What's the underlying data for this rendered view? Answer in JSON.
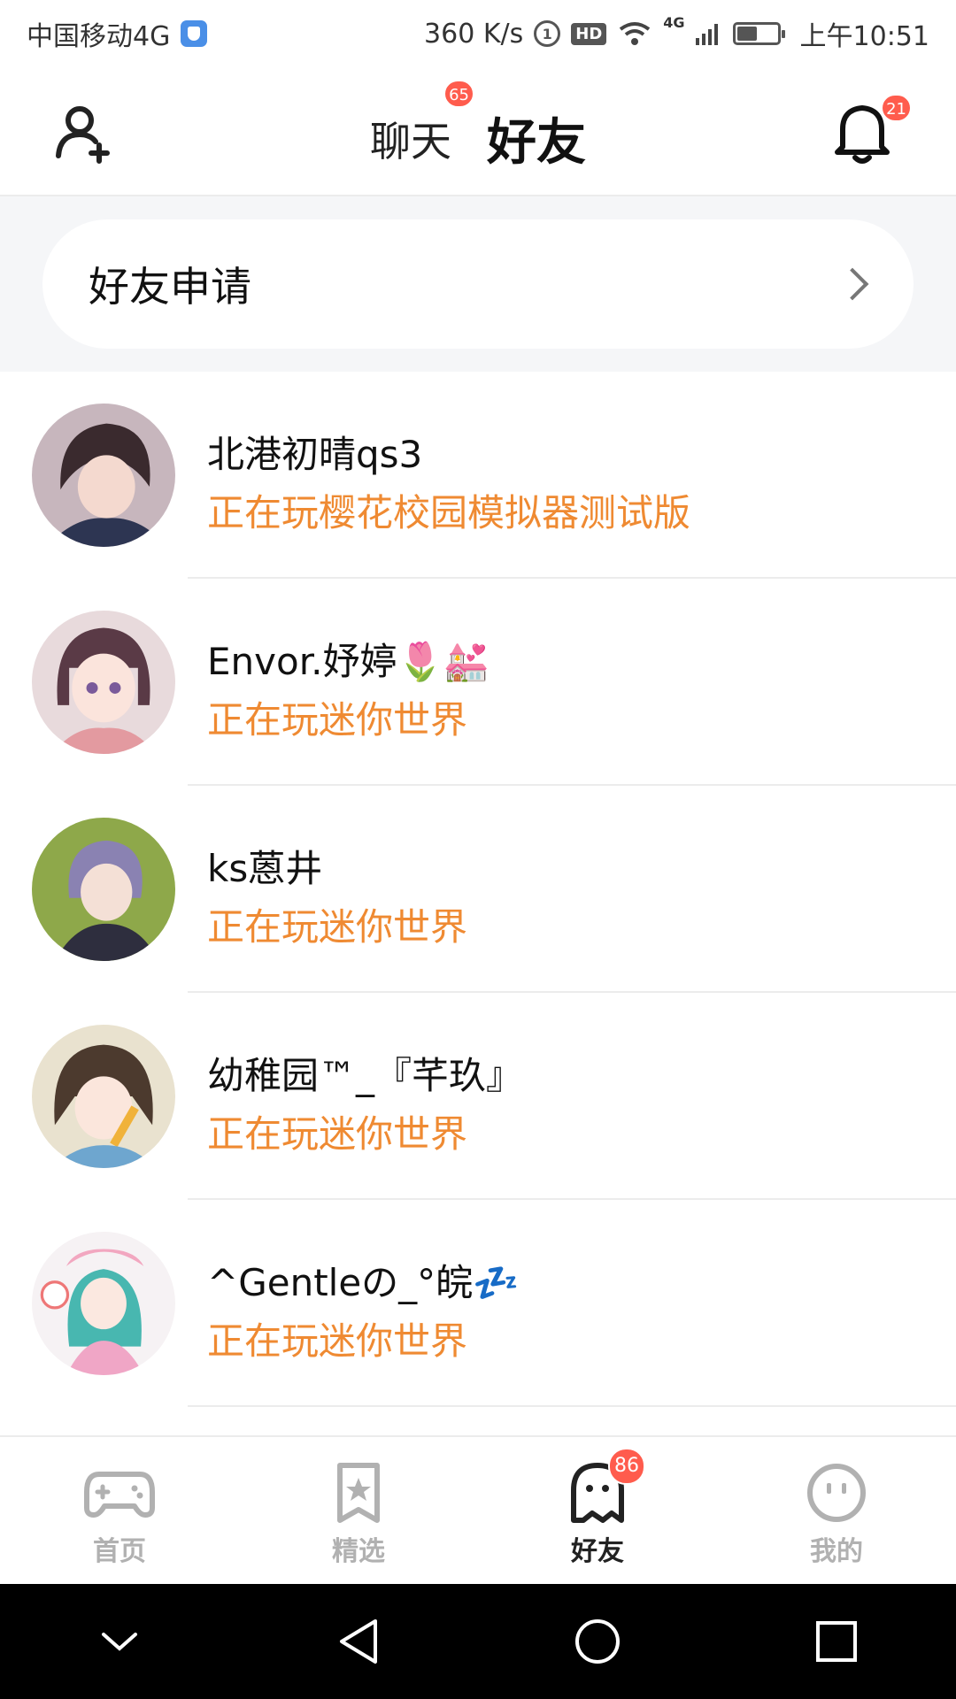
{
  "status_bar": {
    "carrier": "中国移动4G",
    "speed": "360 K/s",
    "hd": "HD",
    "network": "4G",
    "one_badge": "1",
    "time": "上午10:51",
    "battery_level": 0.5
  },
  "header": {
    "tabs": [
      {
        "label": "聊天",
        "badge": "65"
      },
      {
        "label": "好友"
      }
    ],
    "notification_badge": "21"
  },
  "friend_request": {
    "label": "好友申请"
  },
  "friends": [
    {
      "name": "北港初晴qs3",
      "status": "正在玩樱花校园模拟器测试版"
    },
    {
      "name": "Envor.妤婷🌷💒",
      "status": "正在玩迷你世界"
    },
    {
      "name": "ks蒽井",
      "status": "正在玩迷你世界"
    },
    {
      "name": "幼稚园™_『芊玖』",
      "status": "正在玩迷你世界"
    },
    {
      "name": "^Gentleの_°皖💤",
      "status": "正在玩迷你世界"
    }
  ],
  "bottom_nav": {
    "items": [
      {
        "label": "首页",
        "icon": "gamepad-icon"
      },
      {
        "label": "精选",
        "icon": "star-bookmark-icon"
      },
      {
        "label": "好友",
        "icon": "ghost-icon",
        "badge": "86"
      },
      {
        "label": "我的",
        "icon": "face-icon"
      }
    ]
  },
  "colors": {
    "accent": "#ff5a1f",
    "status_text": "#ef8a32",
    "badge": "#ff5c4d"
  }
}
